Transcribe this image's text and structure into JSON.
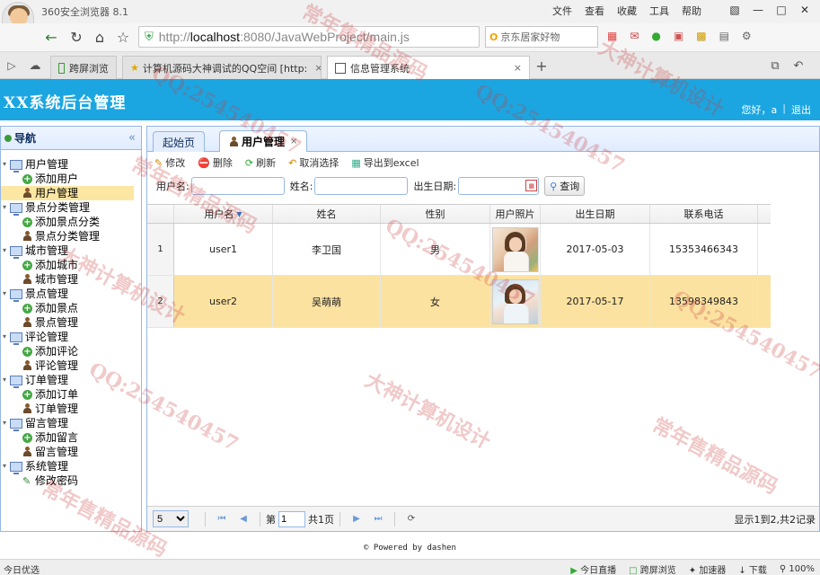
{
  "browser": {
    "name": "360安全浏览器 8.1",
    "menu": [
      "文件",
      "查看",
      "收藏",
      "工具",
      "帮助"
    ],
    "url_scheme": "http://",
    "url_host": "localhost",
    "url_rest": ":8080/JavaWebProject/main.js",
    "search_placeholder": "京东居家好物",
    "tabs": [
      {
        "label": "跨屏浏览"
      },
      {
        "label": "计算机源码大神调试的QQ空间 [http:"
      },
      {
        "label": "信息管理系统"
      }
    ],
    "new_tab": "+"
  },
  "app": {
    "title": "XX系统后台管理",
    "greeting": "您好，a",
    "logout": "退出"
  },
  "nav": {
    "title": "导航",
    "collapse": "«",
    "groups": [
      {
        "label": "用户管理",
        "children": [
          {
            "label": "添加用户",
            "type": "add"
          },
          {
            "label": "用户管理",
            "type": "user",
            "selected": true
          }
        ]
      },
      {
        "label": "景点分类管理",
        "children": [
          {
            "label": "添加景点分类",
            "type": "add"
          },
          {
            "label": "景点分类管理",
            "type": "user"
          }
        ]
      },
      {
        "label": "城市管理",
        "children": [
          {
            "label": "添加城市",
            "type": "add"
          },
          {
            "label": "城市管理",
            "type": "user"
          }
        ]
      },
      {
        "label": "景点管理",
        "children": [
          {
            "label": "添加景点",
            "type": "add"
          },
          {
            "label": "景点管理",
            "type": "user"
          }
        ]
      },
      {
        "label": "评论管理",
        "children": [
          {
            "label": "添加评论",
            "type": "add"
          },
          {
            "label": "评论管理",
            "type": "user"
          }
        ]
      },
      {
        "label": "订单管理",
        "children": [
          {
            "label": "添加订单",
            "type": "add"
          },
          {
            "label": "订单管理",
            "type": "user"
          }
        ]
      },
      {
        "label": "留言管理",
        "children": [
          {
            "label": "添加留言",
            "type": "add"
          },
          {
            "label": "留言管理",
            "type": "user"
          }
        ]
      },
      {
        "label": "系统管理",
        "children": [
          {
            "label": "修改密码",
            "type": "pen"
          }
        ]
      }
    ]
  },
  "main": {
    "tabs": [
      {
        "label": "起始页"
      },
      {
        "label": "用户管理",
        "close": "×"
      }
    ],
    "toolbar": {
      "edit": "修改",
      "delete": "删除",
      "refresh": "刷新",
      "cancel_select": "取消选择",
      "export": "导出到excel"
    },
    "search": {
      "username_label": "用户名:",
      "name_label": "姓名:",
      "birthday_label": "出生日期:",
      "query_button": "查询"
    },
    "columns": [
      "用户名",
      "姓名",
      "性别",
      "用户照片",
      "出生日期",
      "联系电话"
    ],
    "rows": [
      {
        "num": "1",
        "username": "user1",
        "name": "李卫国",
        "gender": "男",
        "birthday": "2017-05-03",
        "phone": "15353466343"
      },
      {
        "num": "2",
        "username": "user2",
        "name": "吴萌萌",
        "gender": "女",
        "birthday": "2017-05-17",
        "phone": "13598349843"
      }
    ],
    "pager": {
      "page_size": "5",
      "page_prefix": "第",
      "page_value": "1",
      "page_suffix": "共1页",
      "info": "显示1到2,共2记录"
    }
  },
  "footer": "© Powered by dashen",
  "statusbar": {
    "left": "今日优选",
    "items": [
      "今日直播",
      "跨屏浏览",
      "加速器",
      "下载",
      "100%"
    ]
  },
  "watermarks": [
    "QQ:254540457",
    "大神计算机设计",
    "常年售精品源码"
  ]
}
